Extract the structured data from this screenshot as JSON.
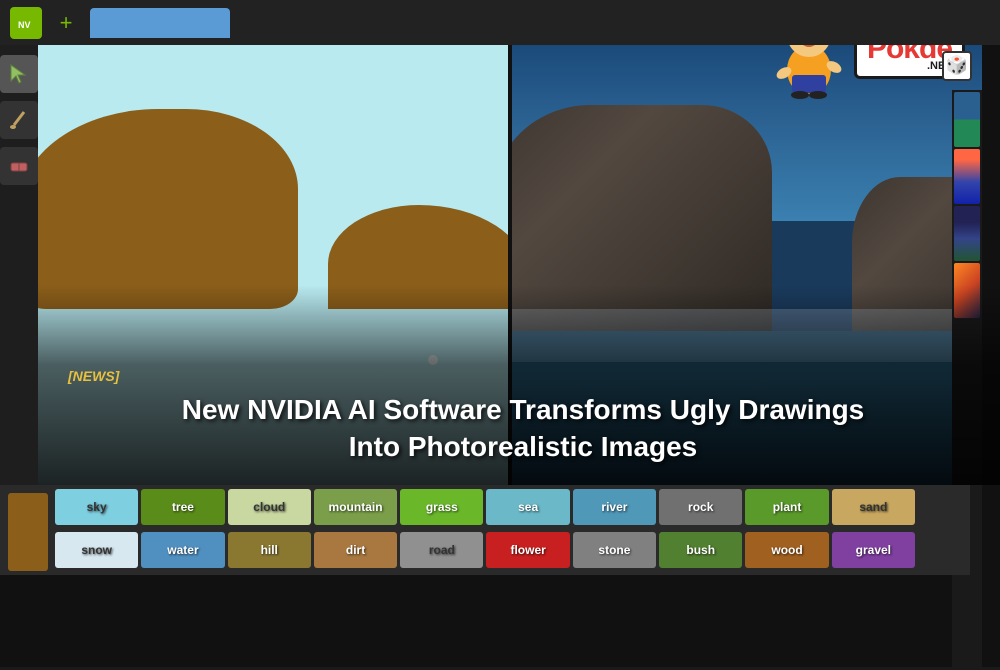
{
  "topbar": {
    "nvidia_label": "NVIDIA",
    "plus_label": "+",
    "tab_title": ""
  },
  "tools": [
    {
      "name": "select-tool",
      "icon": "✏️",
      "label": "Select"
    },
    {
      "name": "draw-tool",
      "icon": "🖌",
      "label": "Draw"
    },
    {
      "name": "eraser-tool",
      "icon": "✏",
      "label": "Eraser"
    }
  ],
  "palette": {
    "row1": [
      {
        "label": "sky",
        "color": "#7ecfe0",
        "text_color": "#333"
      },
      {
        "label": "tree",
        "color": "#5a8c1a",
        "text_color": "#fff"
      },
      {
        "label": "cloud",
        "color": "#c8d8a0",
        "text_color": "#333"
      },
      {
        "label": "mountain",
        "color": "#7a9e4a",
        "text_color": "#fff"
      },
      {
        "label": "grass",
        "color": "#6ab82a",
        "text_color": "#fff"
      },
      {
        "label": "sea",
        "color": "#6ab8c8",
        "text_color": "#fff"
      },
      {
        "label": "river",
        "color": "#5098b8",
        "text_color": "#fff"
      },
      {
        "label": "rock",
        "color": "#707070",
        "text_color": "#fff"
      },
      {
        "label": "plant",
        "color": "#5a9a2a",
        "text_color": "#fff"
      },
      {
        "label": "sand",
        "color": "#c8a860",
        "text_color": "#fff"
      }
    ],
    "row2": [
      {
        "label": "snow",
        "color": "#d8e8f0",
        "text_color": "#333"
      },
      {
        "label": "water",
        "color": "#5090c0",
        "text_color": "#fff"
      },
      {
        "label": "hill",
        "color": "#8a7830",
        "text_color": "#fff"
      },
      {
        "label": "dirt",
        "color": "#a87840",
        "text_color": "#fff"
      },
      {
        "label": "road",
        "color": "#909090",
        "text_color": "#fff"
      },
      {
        "label": "flower",
        "color": "#c82020",
        "text_color": "#fff"
      },
      {
        "label": "stone",
        "color": "#808080",
        "text_color": "#fff"
      },
      {
        "label": "bush",
        "color": "#508030",
        "text_color": "#fff"
      },
      {
        "label": "wood",
        "color": "#a06020",
        "text_color": "#fff"
      },
      {
        "label": "gravel",
        "color": "#8040a0",
        "text_color": "#fff"
      }
    ]
  },
  "overlay": {
    "tag": "[NEWS]",
    "headline": "New NVIDIA AI Software Transforms Ugly Drawings\nInto Photorealistic Images"
  },
  "pokde": {
    "main_text": "Pokde",
    "net_text": ".NET"
  },
  "thumbnails": [
    {
      "label": "thumb-1"
    },
    {
      "label": "thumb-2"
    },
    {
      "label": "thumb-3"
    },
    {
      "label": "thumb-4"
    }
  ],
  "brown_swatch_label": ""
}
